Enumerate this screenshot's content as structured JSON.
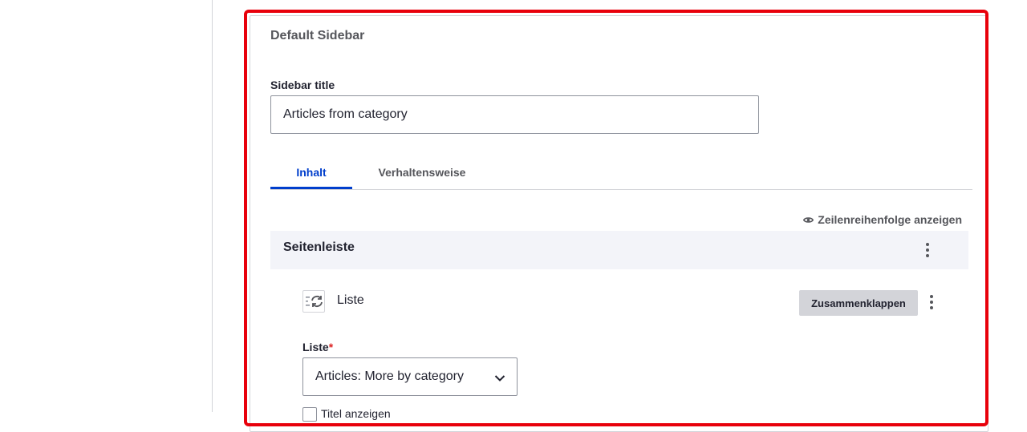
{
  "card": {
    "title": "Default Sidebar"
  },
  "sidebar_title": {
    "label": "Sidebar title",
    "value": "Articles from category"
  },
  "tabs": [
    {
      "label": "Inhalt",
      "active": true
    },
    {
      "label": "Verhaltensweise",
      "active": false
    }
  ],
  "order_toggle": {
    "label": "Zeilenreihenfolge anzeigen",
    "icon": "eye-icon"
  },
  "section": {
    "title": "Seitenleiste",
    "menu_icon": "kebab-menu-icon"
  },
  "paragraph": {
    "type_label": "Liste",
    "icon": "list-reference-icon",
    "collapse_label": "Zusammenklappen",
    "menu_icon": "kebab-menu-icon"
  },
  "list_field": {
    "label": "Liste",
    "required_marker": "*",
    "selected": "Articles: More by category",
    "chevron_icon": "chevron-down-icon"
  },
  "checkbox": {
    "label": "Titel anzeigen",
    "checked": false
  },
  "colors": {
    "highlight": "#e8000b",
    "accent": "#003ecc",
    "section_bg": "#f3f4f9",
    "button_bg": "#d3d4d9",
    "required": "#dc2323"
  }
}
